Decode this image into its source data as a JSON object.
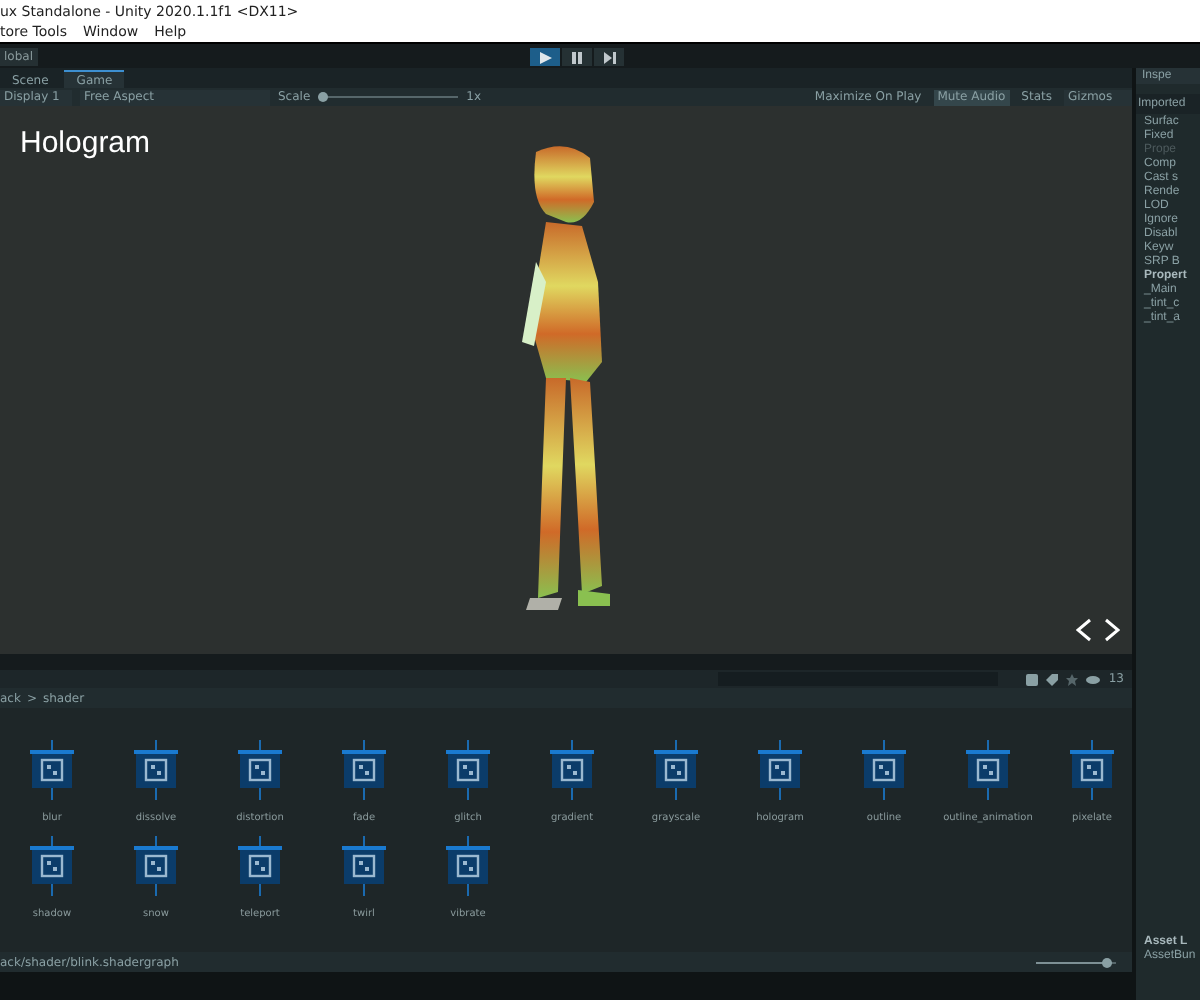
{
  "window": {
    "title": "ux Standalone - Unity 2020.1.1f1 <DX11>"
  },
  "menu": [
    "tore Tools",
    "Window",
    "Help"
  ],
  "toolbar": {
    "layer_label": "lobal",
    "controls": [
      {
        "kind": "play",
        "selected": true
      },
      {
        "kind": "pause",
        "selected": false
      },
      {
        "kind": "step",
        "selected": false
      }
    ]
  },
  "tabs": [
    {
      "label": "Scene",
      "selected": false
    },
    {
      "label": "Game",
      "selected": true
    }
  ],
  "game_toolbar": {
    "display": "Display 1",
    "aspect": "Free Aspect",
    "scale_label": "Scale",
    "scale": {
      "level": 0.0
    },
    "scale_value": "1x",
    "toggles": [
      {
        "label": "Maximize On Play",
        "on": false
      },
      {
        "label": "Mute Audio",
        "on": true
      },
      {
        "label": "Stats",
        "on": false
      }
    ],
    "gizmos": "Gizmos"
  },
  "game_view": {
    "heading": "Hologram"
  },
  "project": {
    "count": "13",
    "breadcrumb": [
      "ack",
      "shader"
    ],
    "breadcrumb_separator": ">",
    "assets": [
      "blur",
      "dissolve",
      "distortion",
      "fade",
      "glitch",
      "gradient",
      "grayscale",
      "hologram",
      "outline",
      "outline_animation",
      "pixelate",
      "shadow",
      "snow",
      "teleport",
      "twirl",
      "vibrate"
    ],
    "path": "ack/shader/blink.shadergraph",
    "zoom": {
      "level": 0.95
    }
  },
  "inspector": {
    "tab": "Inspe",
    "section": "Imported",
    "properties": [
      {
        "label": "Surfac",
        "disabled": false
      },
      {
        "label": "Fixed",
        "disabled": false
      },
      {
        "label": "Prope",
        "disabled": true
      },
      {
        "label": "Comp",
        "disabled": false
      },
      {
        "label": "Cast s",
        "disabled": false
      },
      {
        "label": "Rende",
        "disabled": false
      },
      {
        "label": "LOD",
        "disabled": false
      },
      {
        "label": "Ignore",
        "disabled": false
      },
      {
        "label": "Disabl",
        "disabled": false
      },
      {
        "label": "Keyw",
        "disabled": false
      },
      {
        "label": "SRP B",
        "disabled": false
      }
    ],
    "properties_heading": "Propert",
    "shader_properties": [
      "_Main",
      "_tint_c",
      "_tint_a"
    ],
    "asset_labels": "Asset L",
    "asset_bundle": "AssetBun"
  }
}
